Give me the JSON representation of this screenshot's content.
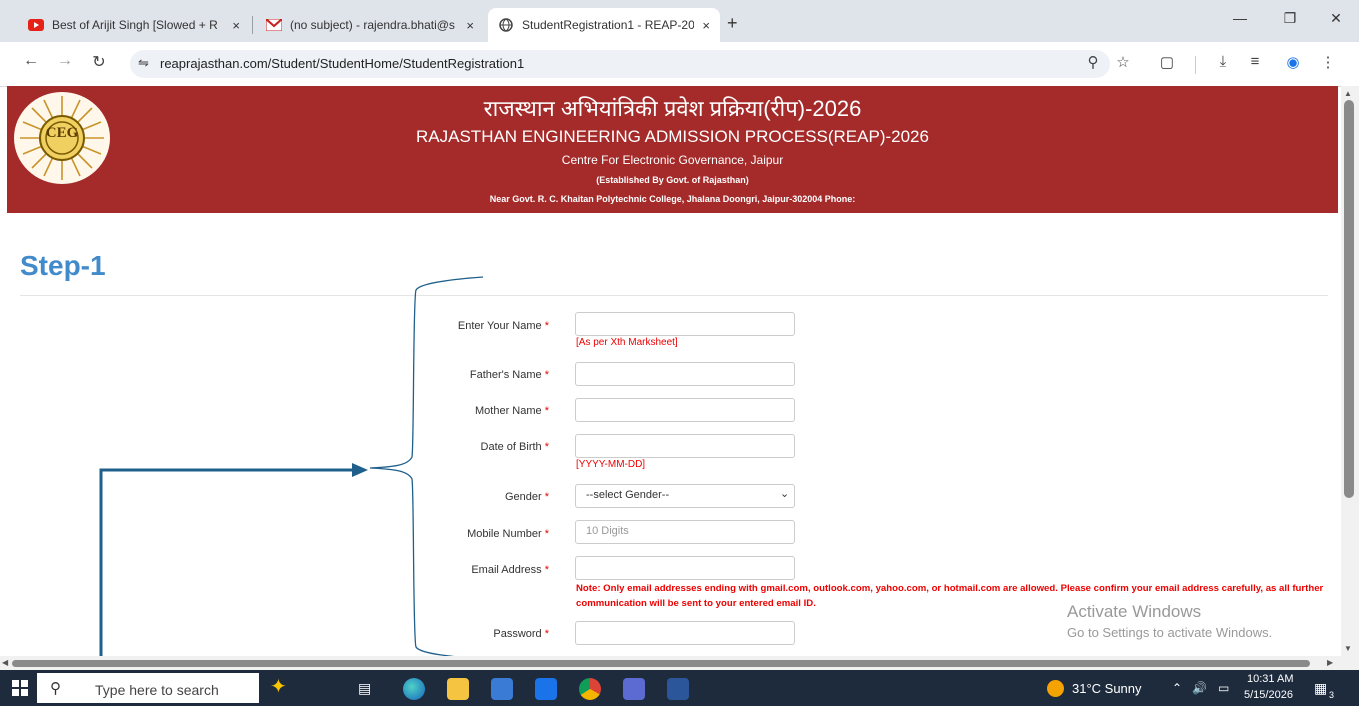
{
  "browser": {
    "tabs": [
      {
        "label": "Best of Arijit Singh [Slowed + R",
        "icon": "youtube-icon"
      },
      {
        "label": "(no subject) - rajendra.bhati@s",
        "icon": "gmail-icon"
      },
      {
        "label": "StudentRegistration1 - REAP-20",
        "icon": "globe-icon"
      }
    ],
    "url": "reaprajasthan.com/Student/StudentHome/StudentRegistration1",
    "new_tab": "+",
    "close": "×"
  },
  "banner": {
    "title_hindi": "राजस्थान अभियांत्रिकी प्रवेश प्रक्रिया(रीप)-2026",
    "title_english": "RAJASTHAN ENGINEERING ADMISSION PROCESS(REAP)-2026",
    "org": "Centre For Electronic Governance, Jaipur",
    "established": "(Established By Govt. of Rajasthan)",
    "address": "Near Govt. R. C. Khaitan Polytechnic College, Jhalana Doongri, Jaipur-302004 Phone:",
    "logo_text": "CEG"
  },
  "form": {
    "step_title": "Step-1",
    "required_mark": "*",
    "fields": {
      "name": {
        "label": "Enter Your Name",
        "hint": "[As per Xth Marksheet]"
      },
      "father": {
        "label": "Father's Name"
      },
      "mother": {
        "label": "Mother Name"
      },
      "dob": {
        "label": "Date of Birth",
        "hint": "[YYYY-MM-DD]"
      },
      "gender": {
        "label": "Gender",
        "selected": "--select Gender--"
      },
      "mobile": {
        "label": "Mobile Number",
        "placeholder": "10 Digits"
      },
      "email": {
        "label": "Email Address",
        "note": "Note: Only email addresses ending with gmail.com, outlook.com, yahoo.com, or hotmail.com are allowed. Please confirm your email address carefully, as all further communication will be sent to your entered email ID."
      },
      "password": {
        "label": "Password"
      }
    }
  },
  "watermark": {
    "line1": "Activate Windows",
    "line2": "Go to Settings to activate Windows."
  },
  "taskbar": {
    "search_placeholder": "Type here to search",
    "weather": "31°C  Sunny",
    "time": "10:31 AM",
    "date": "5/15/2026",
    "notification_count": "3"
  },
  "colors": {
    "banner": "#a52a2a",
    "step_title": "#428bca",
    "required": "#ee0000",
    "annotation": "#1f5f8b"
  }
}
